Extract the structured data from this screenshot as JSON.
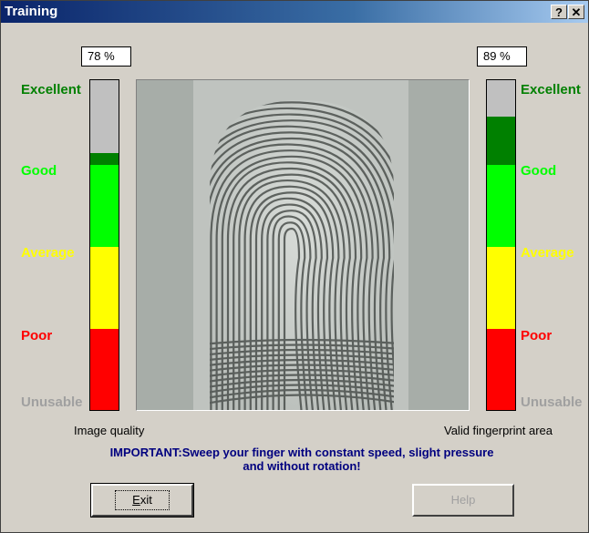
{
  "window": {
    "title": "Training",
    "help_glyph": "?",
    "close_glyph": "✕"
  },
  "levels": {
    "excellent": "Excellent",
    "good": "Good",
    "average": "Average",
    "poor": "Poor",
    "unusable": "Unusable"
  },
  "left_meter": {
    "percent_text": "78 %",
    "value": 0.78,
    "caption": "Image quality"
  },
  "right_meter": {
    "percent_text": "89 %",
    "value": 0.89,
    "caption": "Valid fingerprint area"
  },
  "message": {
    "line1": "IMPORTANT:Sweep your finger with constant speed, slight pressure",
    "line2": "and without rotation!"
  },
  "buttons": {
    "exit": "Exit",
    "help": "Help"
  },
  "colors": {
    "excellent": "#008000",
    "good": "#00ff00",
    "average": "#ffff00",
    "poor": "#ff0000",
    "unusable": "#c0c0c0",
    "level_gray": "#a0a0a0"
  },
  "icons": {
    "fingerprint": "fingerprint-image"
  }
}
